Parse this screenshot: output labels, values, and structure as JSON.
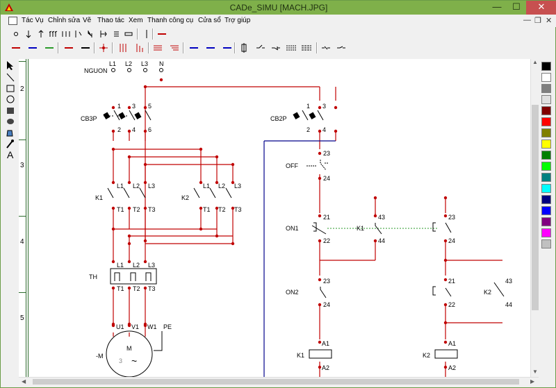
{
  "window": {
    "title": "CADe_SIMU    [MACH.JPG]",
    "minimize": "—",
    "maximize": "☐",
    "close": "✕"
  },
  "menu": [
    {
      "label": "Tác Vụ"
    },
    {
      "label": "Chỉnh sửa"
    },
    {
      "label": "Vẽ"
    },
    {
      "label": "Thao tác"
    },
    {
      "label": "Xem"
    },
    {
      "label": "Thanh công cụ"
    },
    {
      "label": "Cửa sổ"
    },
    {
      "label": "Trợ giúp"
    }
  ],
  "mdi_controls": {
    "minimize": "—",
    "restore": "❐",
    "close": "✕"
  },
  "ruler": [
    "2",
    "3",
    "4",
    "5"
  ],
  "palette": [
    "#000000",
    "#ffffff",
    "#808080",
    "#e0e0e0",
    "#800000",
    "#ff0000",
    "#808000",
    "#ffff00",
    "#008000",
    "#00ff00",
    "#008080",
    "#00ffff",
    "#000080",
    "#0000ff",
    "#800080",
    "#ff00ff",
    "#c0c0c0"
  ],
  "diagram": {
    "wire_color": "#c00000",
    "terminal_color": "#c00000",
    "blue_wire_color": "#00008b",
    "power_labels": {
      "nguon": "NGUON",
      "l1": "L1",
      "l2": "L2",
      "l3": "L3",
      "n": "N"
    },
    "cb3p": {
      "name": "CB3P",
      "t1": "1",
      "t3": "3",
      "t5": "5",
      "t2": "2",
      "t4": "4",
      "t6": "6"
    },
    "cb2p": {
      "name": "CB2P",
      "t1": "1",
      "t3": "3",
      "t2": "2",
      "t4": "4"
    },
    "k1": {
      "name": "K1",
      "in": [
        "L1",
        "L2",
        "L3"
      ],
      "out": [
        "T1",
        "T2",
        "T3"
      ]
    },
    "k2": {
      "name": "K2",
      "in": [
        "L1",
        "L2",
        "L3"
      ],
      "out": [
        "T1",
        "T2",
        "T3"
      ]
    },
    "th": {
      "name": "TH",
      "in": [
        "L1",
        "L2",
        "L3"
      ],
      "out": [
        "T1",
        "T2",
        "T3"
      ]
    },
    "motor": {
      "name": "-M",
      "m": "M",
      "phase": "3",
      "tilde": "~",
      "terms": [
        "U1",
        "V1",
        "W1"
      ],
      "pe": "PE"
    },
    "off": {
      "name": "OFF",
      "a": "23",
      "b": "24"
    },
    "on1": {
      "name": "ON1",
      "a": "21",
      "b": "22"
    },
    "k1_aux": {
      "name": "K1",
      "a": "43",
      "b": "44"
    },
    "k2_nc": {
      "a": "23",
      "b": "24"
    },
    "on2": {
      "name": "ON2",
      "a": "23",
      "b": "24"
    },
    "k2_nc2": {
      "a": "21",
      "b": "22"
    },
    "k2_aux": {
      "name": "K2",
      "a": "43",
      "b": "44"
    },
    "coil_k1": {
      "name": "K1",
      "a1": "A1",
      "a2": "A2"
    },
    "coil_k2": {
      "name": "K2",
      "a1": "A1",
      "a2": "A2"
    }
  }
}
